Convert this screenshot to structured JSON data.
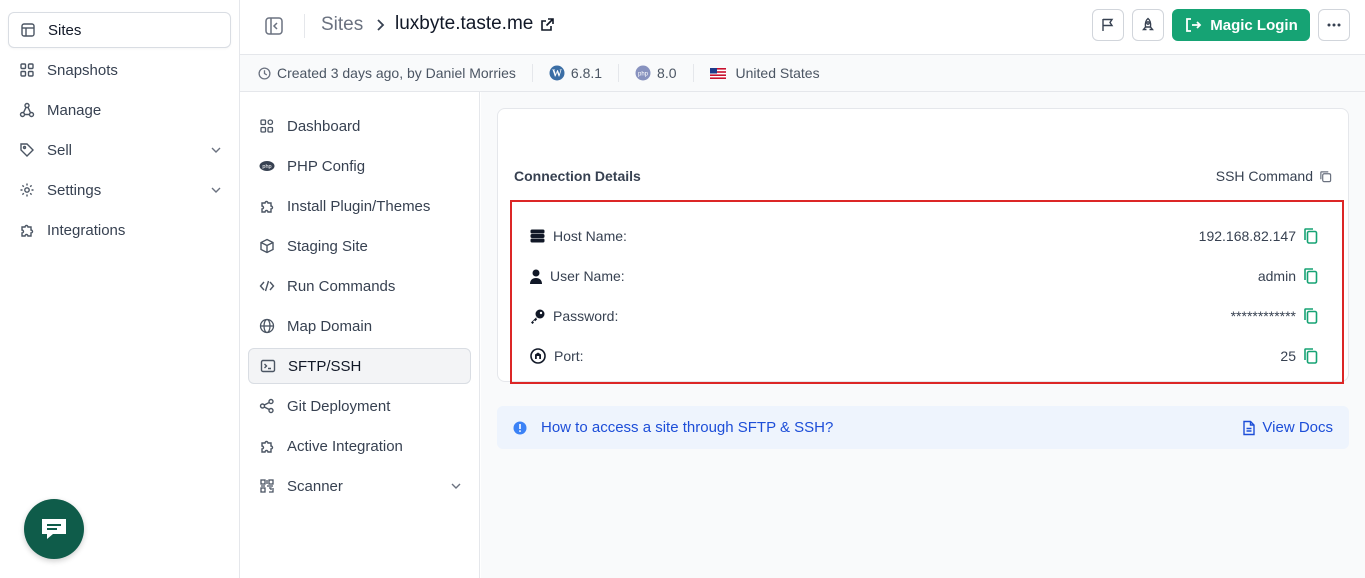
{
  "sidebar": {
    "items": [
      {
        "label": "Sites",
        "icon": "layout-icon"
      },
      {
        "label": "Snapshots",
        "icon": "grid-icon"
      },
      {
        "label": "Manage",
        "icon": "network-icon"
      },
      {
        "label": "Sell",
        "icon": "tag-icon"
      },
      {
        "label": "Settings",
        "icon": "gear-icon"
      },
      {
        "label": "Integrations",
        "icon": "puzzle-icon"
      }
    ]
  },
  "header": {
    "breadcrumb_root": "Sites",
    "site_name": "luxbyte.taste.me",
    "magic_login": "Magic Login"
  },
  "subbar": {
    "created": "Created 3 days ago, by Daniel Morries",
    "wp_version": "6.8.1",
    "php_version": "8.0",
    "country": "United States"
  },
  "site_nav": {
    "items": [
      {
        "label": "Dashboard"
      },
      {
        "label": "PHP Config"
      },
      {
        "label": "Install Plugin/Themes"
      },
      {
        "label": "Staging Site"
      },
      {
        "label": "Run Commands"
      },
      {
        "label": "Map Domain"
      },
      {
        "label": "SFTP/SSH"
      },
      {
        "label": "Git Deployment"
      },
      {
        "label": "Active Integration"
      },
      {
        "label": "Scanner"
      }
    ]
  },
  "connection": {
    "title": "Connection Details",
    "ssh_command": "SSH Command",
    "rows": [
      {
        "label": "Host Name:",
        "value": "192.168.82.147"
      },
      {
        "label": "User Name:",
        "value": "admin"
      },
      {
        "label": "Password:",
        "value": "************"
      },
      {
        "label": "Port:",
        "value": "25"
      }
    ]
  },
  "info": {
    "question": "How to access a site through SFTP & SSH?",
    "docs": "View Docs"
  },
  "colors": {
    "accent": "#16a374",
    "highlight": "#dc2626",
    "link": "#1d4ed8"
  }
}
